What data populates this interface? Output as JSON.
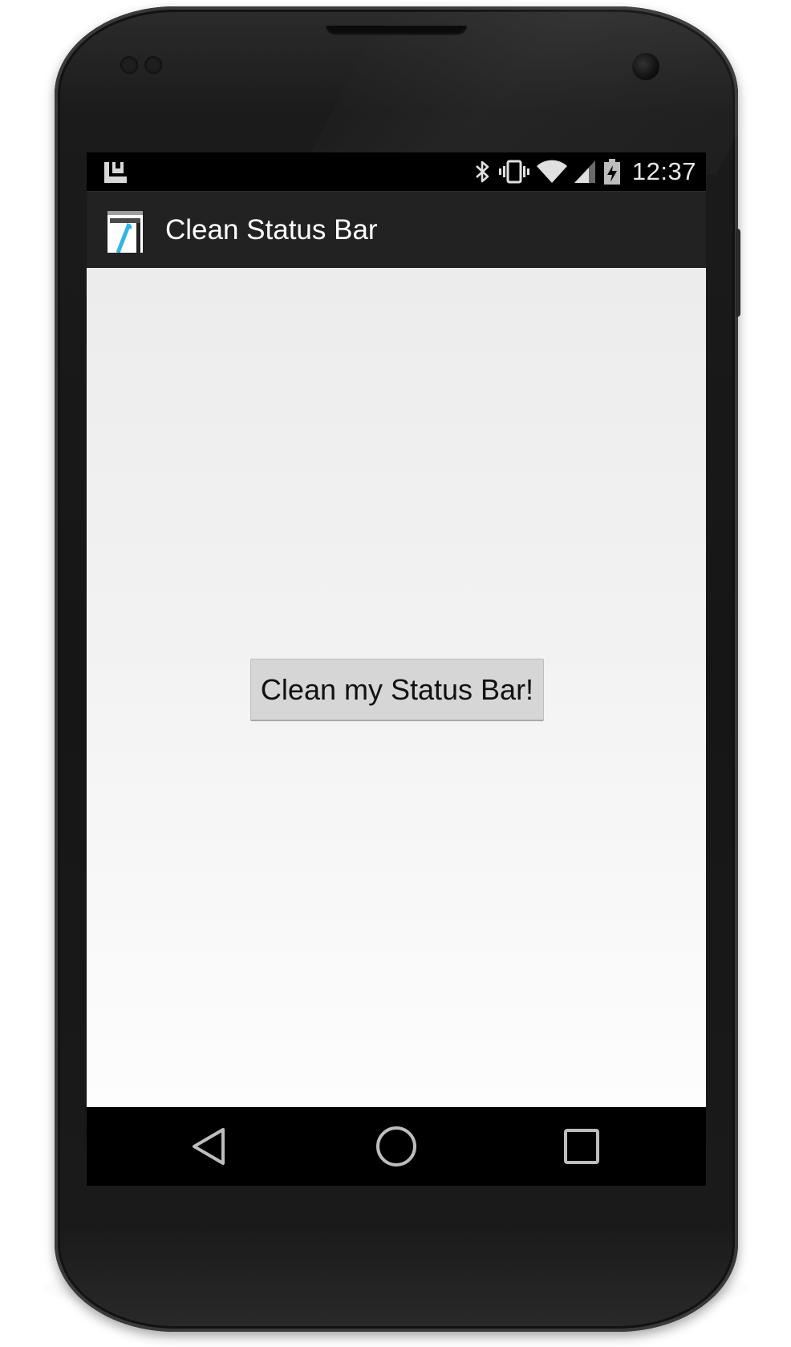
{
  "status_bar": {
    "time": "12:37",
    "left_icon": "notification-icon",
    "icons": [
      "bluetooth-icon",
      "vibrate-icon",
      "wifi-icon",
      "cell-signal-icon",
      "battery-charging-icon"
    ]
  },
  "action_bar": {
    "app_icon": "app-launcher-icon",
    "title": "Clean Status Bar"
  },
  "main": {
    "button_label": "Clean my Status Bar!"
  },
  "nav_bar": {
    "items": [
      "back-icon",
      "home-icon",
      "recents-icon"
    ]
  },
  "colors": {
    "status_bar": "#000000",
    "action_bar": "#222222",
    "content_top": "#ececec",
    "content_bottom": "#fdfdfd",
    "button": "#d6d6d6",
    "accent": "#33b5e5"
  }
}
